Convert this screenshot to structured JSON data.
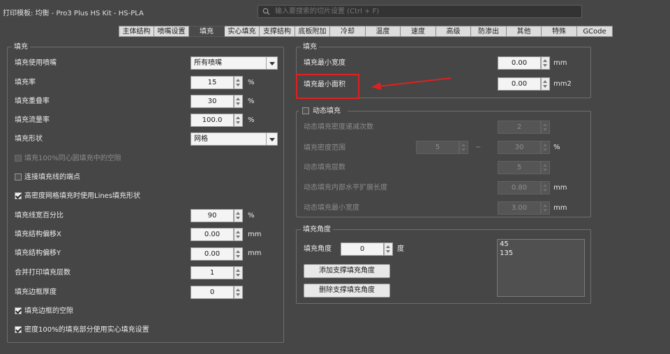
{
  "window_title": "打印模板: 均衡 - Pro3 Plus HS Kit - HS-PLA",
  "search": {
    "placeholder": "输入要搜索的切片设置 (Ctrl + F)"
  },
  "tabs": [
    "主体结构",
    "喷嘴设置",
    "填充",
    "实心填充",
    "支撑结构",
    "底板附加",
    "冷却",
    "温度",
    "速度",
    "高级",
    "防渗出",
    "其他",
    "特殊",
    "GCode"
  ],
  "active_tab": "填充",
  "left_group": {
    "title": "填充",
    "nozzle": {
      "label": "填充使用喷嘴",
      "value": "所有喷嘴"
    },
    "infill_rate": {
      "label": "填充率",
      "value": "15",
      "unit": "%"
    },
    "overlap": {
      "label": "填充重叠率",
      "value": "30",
      "unit": "%"
    },
    "flow": {
      "label": "填充流量率",
      "value": "100.0",
      "unit": "%"
    },
    "shape": {
      "label": "填充形状",
      "value": "网格"
    },
    "cb_concentric": {
      "label": "填充100%同心圆填充中的空隙",
      "checked": false,
      "enabled": false
    },
    "cb_connect": {
      "label": "连接填充线的端点",
      "checked": false,
      "enabled": true
    },
    "cb_lines": {
      "label": "高密度网格填充时使用Lines填充形状",
      "checked": true,
      "enabled": true
    },
    "line_width": {
      "label": "填充线宽百分比",
      "value": "90",
      "unit": "%"
    },
    "offset_x": {
      "label": "填充结构偏移X",
      "value": "0.00",
      "unit": "mm"
    },
    "offset_y": {
      "label": "填充结构偏移Y",
      "value": "0.00",
      "unit": "mm"
    },
    "combine": {
      "label": "合并打印填充层数",
      "value": "1"
    },
    "border": {
      "label": "填充边框厚度",
      "value": "0"
    },
    "cb_border_gap": {
      "label": "填充边框的空隙",
      "checked": true,
      "enabled": true
    },
    "cb_solid": {
      "label": "密度100%的填充部分使用实心填充设置",
      "checked": true,
      "enabled": true
    }
  },
  "right_group": {
    "title": "填充",
    "min_width": {
      "label": "填充最小宽度",
      "value": "0.00",
      "unit": "mm"
    },
    "min_area": {
      "label": "填充最小面积",
      "value": "0.00",
      "unit": "mm2"
    }
  },
  "dynamic_group": {
    "title": "动态填充",
    "checked": false,
    "reduce": {
      "label": "动态填充密度递减次数",
      "value": "2"
    },
    "range": {
      "label": "填充密度范围",
      "from": "5",
      "dash": "−",
      "to": "30",
      "unit": "%"
    },
    "layers": {
      "label": "动态填充层数",
      "value": "5"
    },
    "expand": {
      "label": "动态填充内部水平扩展长度",
      "value": "0.80",
      "unit": "mm"
    },
    "min_width": {
      "label": "动态填充最小宽度",
      "value": "3.00",
      "unit": "mm"
    }
  },
  "angle_group": {
    "title": "填充角度",
    "angle": {
      "label": "填充角度",
      "value": "0",
      "unit": "度"
    },
    "add_button": "添加支撑填充角度",
    "delete_button": "删除支撑填充角度",
    "angles": [
      "45",
      "135"
    ]
  },
  "colors": {
    "background": "#464646",
    "highlight": "#e02020"
  }
}
